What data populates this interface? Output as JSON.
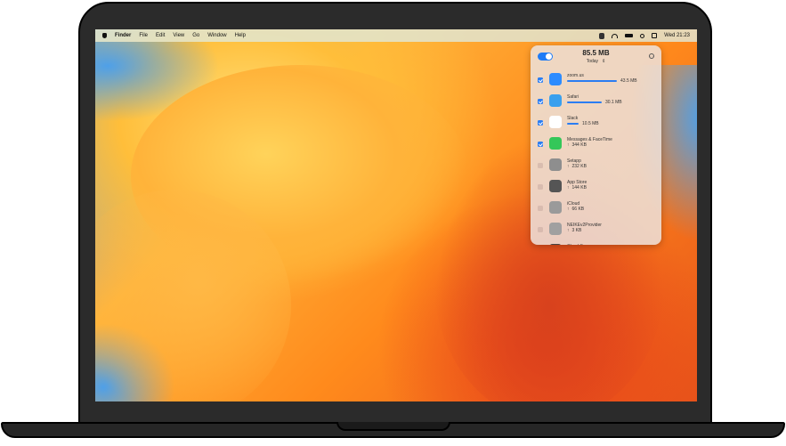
{
  "menubar": {
    "apple_icon": "apple-logo-icon",
    "items": [
      "Finder",
      "File",
      "Edit",
      "View",
      "Go",
      "Window",
      "Help"
    ],
    "clock": "Wed 21:23"
  },
  "panel": {
    "enabled": true,
    "total": "85.5 MB",
    "period": "Today",
    "period_chevron": "⇕",
    "more_glyph": "…",
    "apps": [
      {
        "name": "zoom.us",
        "checked": true,
        "bar": 0.83,
        "value": "43.5 MB",
        "icon": "zoom-app-icon",
        "color": "#2d8cff"
      },
      {
        "name": "Safari",
        "checked": true,
        "bar": 0.58,
        "value": "30.1 MB",
        "icon": "safari-app-icon",
        "color": "#3aa0ee"
      },
      {
        "name": "Slack",
        "checked": true,
        "bar": 0.2,
        "value": "10.5 MB",
        "icon": "slack-app-icon",
        "color": "#ffffff"
      },
      {
        "name": "Messages & FaceTime",
        "checked": true,
        "bar": 0,
        "value": "344 KB",
        "arrow": "↑",
        "icon": "messages-app-icon",
        "color": "#34c759"
      },
      {
        "name": "Setapp",
        "checked": false,
        "bar": 0,
        "value": "232 KB",
        "arrow": "↑",
        "icon": "setapp-app-icon",
        "color": "#8e8e8e"
      },
      {
        "name": "App Store",
        "checked": false,
        "bar": 0,
        "value": "144 KB",
        "arrow": "↑",
        "icon": "app-store-icon",
        "color": "#555555"
      },
      {
        "name": "iCloud",
        "checked": false,
        "bar": 0,
        "value": "66 KB",
        "arrow": "↑",
        "icon": "icloud-icon",
        "color": "#9a9a9a"
      },
      {
        "name": "NEIKEv2Provider",
        "checked": false,
        "bar": 0,
        "value": "3 KB",
        "arrow": "↑",
        "icon": "shield-app-icon",
        "color": "#a0a0a0"
      },
      {
        "name": "Cloud Sync",
        "checked": false,
        "bar": 0,
        "value": "",
        "icon": "cloud-sync-icon",
        "color": "#444444"
      }
    ]
  }
}
